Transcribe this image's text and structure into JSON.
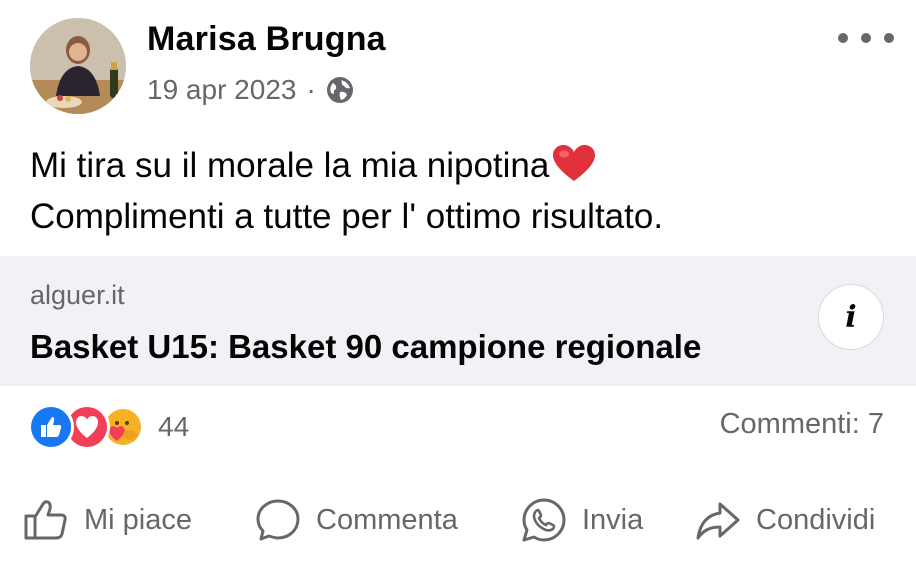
{
  "post": {
    "author": "Marisa Brugna",
    "date": "19 apr 2023",
    "separator": "·",
    "privacy_icon": "globe-icon",
    "text_line1": "Mi tira su il morale la mia nipotina",
    "text_line2": "Complimenti a tutte per l' ottimo risultato."
  },
  "link_preview": {
    "domain": "alguer.it",
    "title": "Basket U15: Basket 90 campione regionale",
    "info_label": "i"
  },
  "engagement": {
    "reaction_icons": [
      "like-icon",
      "love-icon",
      "care-icon"
    ],
    "reaction_count": "44",
    "comments_label": "Commenti: 7"
  },
  "actions": {
    "like": "Mi piace",
    "comment": "Commenta",
    "send": "Invia",
    "share": "Condividi"
  },
  "colors": {
    "secondary_text": "#65676b",
    "link_bg": "#f0f2f5",
    "like_blue": "#1877f2",
    "love_red": "#f33e58",
    "care_yellow": "#f7b125"
  }
}
